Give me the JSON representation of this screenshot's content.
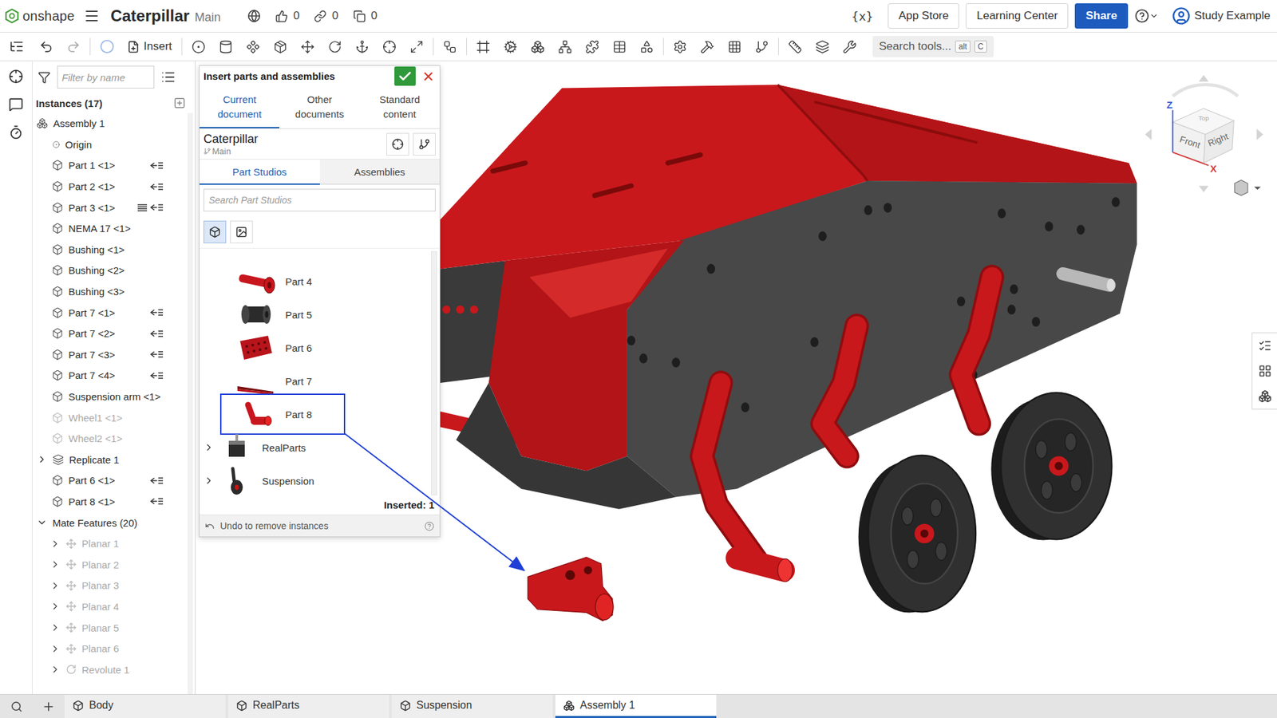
{
  "header": {
    "logo": "onshape",
    "document": "Caterpillar",
    "branch": "Main",
    "stats": [
      {
        "kind": "likes",
        "value": "0"
      },
      {
        "kind": "links",
        "value": "0"
      },
      {
        "kind": "copies",
        "value": "0"
      }
    ],
    "variables": "{x}",
    "buttons": [
      {
        "label": "App Store",
        "primary": false
      },
      {
        "label": "Learning Center",
        "primary": false
      },
      {
        "label": "Share",
        "primary": true
      }
    ],
    "user": "Study Example"
  },
  "toolbar": {
    "insert": "Insert",
    "search": {
      "placeholder": "Search tools...",
      "keys": [
        "alt",
        "C"
      ]
    }
  },
  "instances": {
    "filter_placeholder": "Filter by name",
    "title": "Instances (17)",
    "items": [
      {
        "name": "Assembly 1",
        "kind": "assembly",
        "mated": false,
        "replicated": false,
        "suppressed": false
      },
      {
        "name": "Origin",
        "kind": "origin",
        "mated": false,
        "replicated": false,
        "suppressed": false
      },
      {
        "name": "Part 1 <1>",
        "kind": "part",
        "mated": true,
        "replicated": false,
        "suppressed": false
      },
      {
        "name": "Part 2 <1>",
        "kind": "part",
        "mated": true,
        "replicated": false,
        "suppressed": false
      },
      {
        "name": "Part 3 <1>",
        "kind": "part",
        "mated": true,
        "replicated": true,
        "suppressed": false
      },
      {
        "name": "NEMA 17 <1>",
        "kind": "part",
        "mated": false,
        "replicated": false,
        "suppressed": false
      },
      {
        "name": "Bushing <1>",
        "kind": "part",
        "mated": false,
        "replicated": false,
        "suppressed": false
      },
      {
        "name": "Bushing <2>",
        "kind": "part",
        "mated": false,
        "replicated": false,
        "suppressed": false
      },
      {
        "name": "Bushing <3>",
        "kind": "part",
        "mated": false,
        "replicated": false,
        "suppressed": false
      },
      {
        "name": "Part 7 <1>",
        "kind": "part",
        "mated": true,
        "replicated": false,
        "suppressed": false
      },
      {
        "name": "Part 7 <2>",
        "kind": "part",
        "mated": true,
        "replicated": false,
        "suppressed": false
      },
      {
        "name": "Part 7 <3>",
        "kind": "part",
        "mated": true,
        "replicated": false,
        "suppressed": false
      },
      {
        "name": "Part 7 <4>",
        "kind": "part",
        "mated": true,
        "replicated": false,
        "suppressed": false
      },
      {
        "name": "Suspension arm <1>",
        "kind": "part",
        "mated": false,
        "replicated": false,
        "suppressed": false
      },
      {
        "name": "Wheel1 <1>",
        "kind": "part",
        "mated": false,
        "replicated": false,
        "suppressed": true
      },
      {
        "name": "Wheel2 <1>",
        "kind": "part",
        "mated": false,
        "replicated": false,
        "suppressed": true
      },
      {
        "name": "Replicate 1",
        "kind": "replicate",
        "expanded": false,
        "mated": false,
        "replicated": false,
        "suppressed": false
      },
      {
        "name": "Part 6 <1>",
        "kind": "part",
        "mated": true,
        "replicated": false,
        "suppressed": false
      },
      {
        "name": "Part 8 <1>",
        "kind": "part",
        "mated": true,
        "replicated": false,
        "suppressed": false
      }
    ],
    "mates": {
      "title": "Mate Features (20)",
      "expanded": true,
      "items": [
        {
          "name": "Planar 1",
          "kind": "planar",
          "expanded": false
        },
        {
          "name": "Planar 2",
          "kind": "planar",
          "expanded": false
        },
        {
          "name": "Planar 3",
          "kind": "planar",
          "expanded": false
        },
        {
          "name": "Planar 4",
          "kind": "planar",
          "expanded": false
        },
        {
          "name": "Planar 5",
          "kind": "planar",
          "expanded": false
        },
        {
          "name": "Planar 6",
          "kind": "planar",
          "expanded": false
        },
        {
          "name": "Revolute 1",
          "kind": "revolute",
          "expanded": false
        }
      ]
    }
  },
  "insert_dialog": {
    "title": "Insert parts and assemblies",
    "tabs": [
      {
        "label": "Current document",
        "selected": true
      },
      {
        "label": "Other documents",
        "selected": false
      },
      {
        "label": "Standard content",
        "selected": false
      }
    ],
    "document": {
      "name": "Caterpillar",
      "branch": "Main"
    },
    "subtabs": [
      {
        "label": "Part Studios",
        "selected": true
      },
      {
        "label": "Assemblies",
        "selected": false
      }
    ],
    "search_placeholder": "Search Part Studios",
    "view_modes": [
      {
        "kind": "thumbnails",
        "selected": true
      },
      {
        "kind": "list",
        "selected": false
      }
    ],
    "items": [
      {
        "name": "Part 4",
        "kind": "part",
        "thumb": "bolt",
        "color": "#c8161e",
        "highlighted": false
      },
      {
        "name": "Part 5",
        "kind": "part",
        "thumb": "spool",
        "color": "#2b2b2b",
        "highlighted": false
      },
      {
        "name": "Part 6",
        "kind": "part",
        "thumb": "plate",
        "color": "#b8141b",
        "highlighted": false
      },
      {
        "name": "Part 7",
        "kind": "part",
        "thumb": "bar",
        "color": "#b8141b",
        "highlighted": false
      },
      {
        "name": "Part 8",
        "kind": "part",
        "thumb": "arm",
        "color": "#c8161e",
        "highlighted": true
      },
      {
        "name": "RealParts",
        "kind": "folder",
        "thumb": "motor",
        "color": "#2b2b2b",
        "expanded": false,
        "highlighted": false
      },
      {
        "name": "Suspension",
        "kind": "folder",
        "thumb": "suspension",
        "color": "#2b2b2b",
        "expanded": false,
        "highlighted": false
      }
    ],
    "inserted": "Inserted: 1",
    "undo": "Undo to remove instances"
  },
  "viewport": {
    "view_cube": {
      "front": "Front",
      "right": "Right",
      "top": "Top",
      "axis_z": "Z",
      "axis_x": "X"
    }
  },
  "tabs": [
    {
      "label": "Body",
      "kind": "partstudio",
      "selected": false
    },
    {
      "label": "RealParts",
      "kind": "partstudio",
      "selected": false
    },
    {
      "label": "Suspension",
      "kind": "partstudio",
      "selected": false
    },
    {
      "label": "Assembly 1",
      "kind": "assembly",
      "selected": true
    }
  ]
}
